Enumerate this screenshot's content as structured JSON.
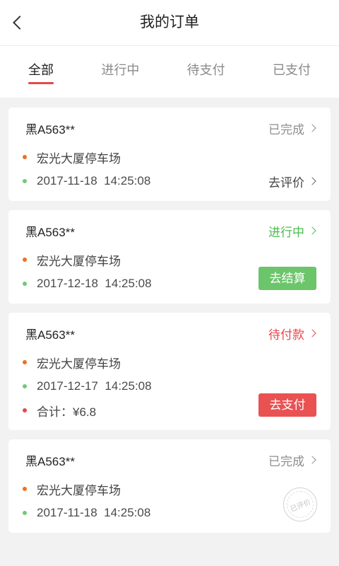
{
  "header": {
    "title": "我的订单",
    "back_icon": "chevron-left-icon"
  },
  "tabs": [
    {
      "label": "全部",
      "active": true
    },
    {
      "label": "进行中",
      "active": false
    },
    {
      "label": "待支付",
      "active": false
    },
    {
      "label": "已支付",
      "active": false
    }
  ],
  "colors": {
    "accent_red": "#e8474b",
    "status_done": "#8e8e8e",
    "status_in_progress": "#4dbb4f",
    "status_unpaid": "#e8474b",
    "dot_location": "#f0701e",
    "dot_time": "#73c873",
    "dot_total": "#e8474b",
    "button_settle": "#6cc56b",
    "button_pay": "#ea5153",
    "page_background": "#f2f2f2"
  },
  "orders": [
    {
      "plate": "黑A563**",
      "status": "已完成",
      "status_icon": "chevron-right-icon",
      "location": "宏光大厦停车场",
      "time": "2017-11-18  14:25:08",
      "action_link": "去评价"
    },
    {
      "plate": "黑A563**",
      "status": "进行中",
      "status_icon": "chevron-right-icon",
      "location": "宏光大厦停车场",
      "time": "2017-12-18  14:25:08",
      "action_button": "去结算"
    },
    {
      "plate": "黑A563**",
      "status": "待付款",
      "status_icon": "chevron-right-icon",
      "location": "宏光大厦停车场",
      "time": "2017-12-17  14:25:08",
      "total": "合计：¥6.8",
      "action_button": "去支付"
    },
    {
      "plate": "黑A563**",
      "status": "已完成",
      "status_icon": "chevron-right-icon",
      "location": "宏光大厦停车场",
      "time": "2017-11-18  14:25:08",
      "stamp": "已评价",
      "stamp_icon": "reviewed-stamp-icon"
    }
  ]
}
